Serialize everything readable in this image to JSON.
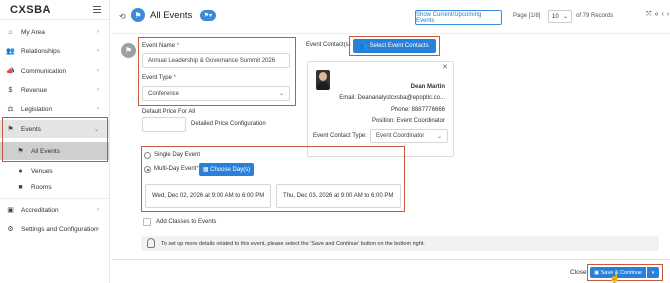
{
  "app": {
    "logo": "CXSBA"
  },
  "sidebar": {
    "items": [
      {
        "label": "My Area",
        "icon": "home-icon"
      },
      {
        "label": "Relationships",
        "icon": "people-icon"
      },
      {
        "label": "Communication",
        "icon": "megaphone-icon"
      },
      {
        "label": "Revenue",
        "icon": "dollar-icon"
      },
      {
        "label": "Legislation",
        "icon": "gavel-icon"
      },
      {
        "label": "Events",
        "icon": "events-icon"
      },
      {
        "label": "All Events",
        "icon": "flag-icon"
      },
      {
        "label": "Venues",
        "icon": "location-pin-icon"
      },
      {
        "label": "Rooms",
        "icon": "square-icon"
      },
      {
        "label": "Accreditation",
        "icon": "certificate-icon"
      },
      {
        "label": "Settings and Configuration",
        "icon": "gears-icon"
      }
    ]
  },
  "header": {
    "title": "All Events",
    "show_button": "Show Current/Upcoming Events",
    "page_label": "Page [1/8]",
    "page_size": "10",
    "records": "of 79 Records"
  },
  "form": {
    "event_name_label": "Event Name",
    "event_name_value": "Annual Leadership & Governance Summit 2026",
    "event_type_label": "Event Type",
    "event_type_value": "Conference",
    "default_price_label": "Default Price For All",
    "detailed_price_label": "Detailed Price Configuration",
    "required_mark": "*",
    "single_day_label": "Single Day Event",
    "multi_day_label": "Multi-Day Event",
    "choose_days_label": "Choose Day(s)",
    "day1": "Wed, Dec 02, 2026 at 9:00 AM to 6:00 PM",
    "day2": "Thu, Dec 03, 2026 at 9:00 AM to 6:00 PM",
    "add_classes_label": "Add Classes to Events",
    "info_text": "To set up more details related to this event, please select the 'Save and Continue' button on the bottom right."
  },
  "contact": {
    "label": "Event Contact(s)",
    "select_button": "Select Event Contacts",
    "name": "Dean Martin",
    "email_line": "Email: Deananalystcxsba@epoptic.co...",
    "phone_line": "Phone: 8887776666",
    "position_line": "Position: Event Coordinator",
    "type_label": "Event Contact Type:",
    "type_value": "Event Coordinator"
  },
  "footer": {
    "close_label": "Close",
    "save_label": "Save & Continue"
  },
  "colors": {
    "accent": "#2a80d9",
    "highlight": "#c8593b"
  }
}
